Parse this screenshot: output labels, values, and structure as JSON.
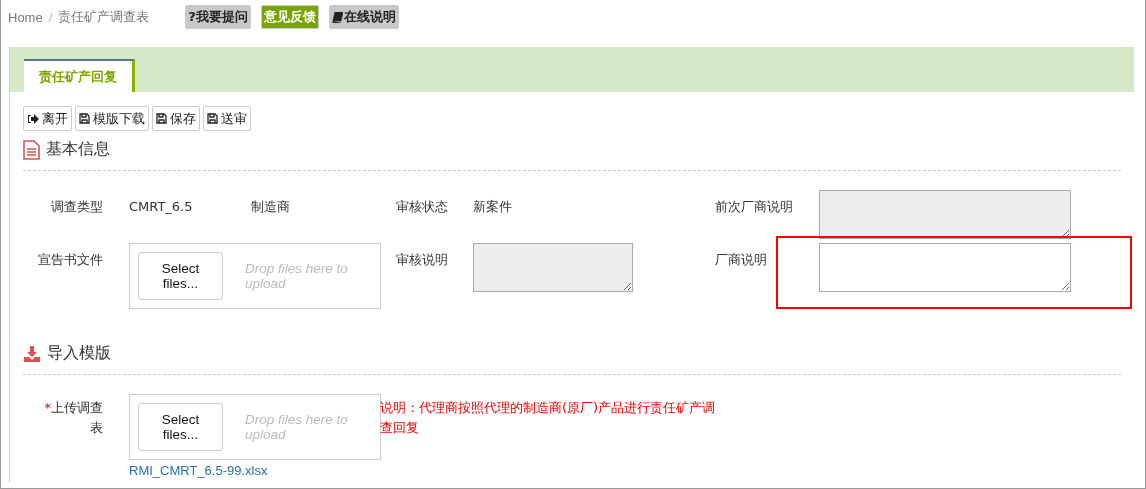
{
  "breadcrumb": [
    {
      "label": "Home"
    },
    {
      "label": "责任矿产调查表"
    }
  ],
  "breadcrumb_separator": "/",
  "header_buttons": [
    {
      "label": "?我要提问",
      "kind": "plain"
    },
    {
      "label": "意见反馈",
      "kind": "green"
    },
    {
      "label": "在线说明",
      "kind": "book"
    }
  ],
  "tabs": [
    {
      "label": "责任矿产回复",
      "selected": true
    }
  ],
  "toolbar": [
    {
      "label": "离开",
      "kind": "exit"
    },
    {
      "label": "模版下载",
      "kind": "save"
    },
    {
      "label": "保存",
      "kind": "save"
    },
    {
      "label": "送审",
      "kind": "save"
    }
  ],
  "basic_info": {
    "title": "基本信息",
    "survey_type": {
      "label": "调查类型",
      "value": "CMRT_6.5",
      "extra": "制造商"
    },
    "review_status": {
      "label": "审核状态",
      "value": "新案件"
    },
    "previous_vendor_note": {
      "label": "前次厂商说明",
      "disabled": true
    },
    "declaration_file": {
      "label": "宣告书文件",
      "button": "Select files...",
      "hint": "Drop files here to upload"
    },
    "review_note": {
      "label": "审核说明",
      "disabled": true
    },
    "vendor_note": {
      "label": "厂商说明",
      "disabled": false,
      "highlighted": true
    }
  },
  "import_template": {
    "title": "导入模版",
    "upload": {
      "label": "上传调查表",
      "required_mark": "*",
      "button": "Select files...",
      "hint": "Drop files here to upload",
      "file": "RMI_CMRT_6.5-99.xlsx"
    },
    "note": "说明：代理商按照代理的制造商(原厂)产品进行责任矿产调查回复"
  }
}
